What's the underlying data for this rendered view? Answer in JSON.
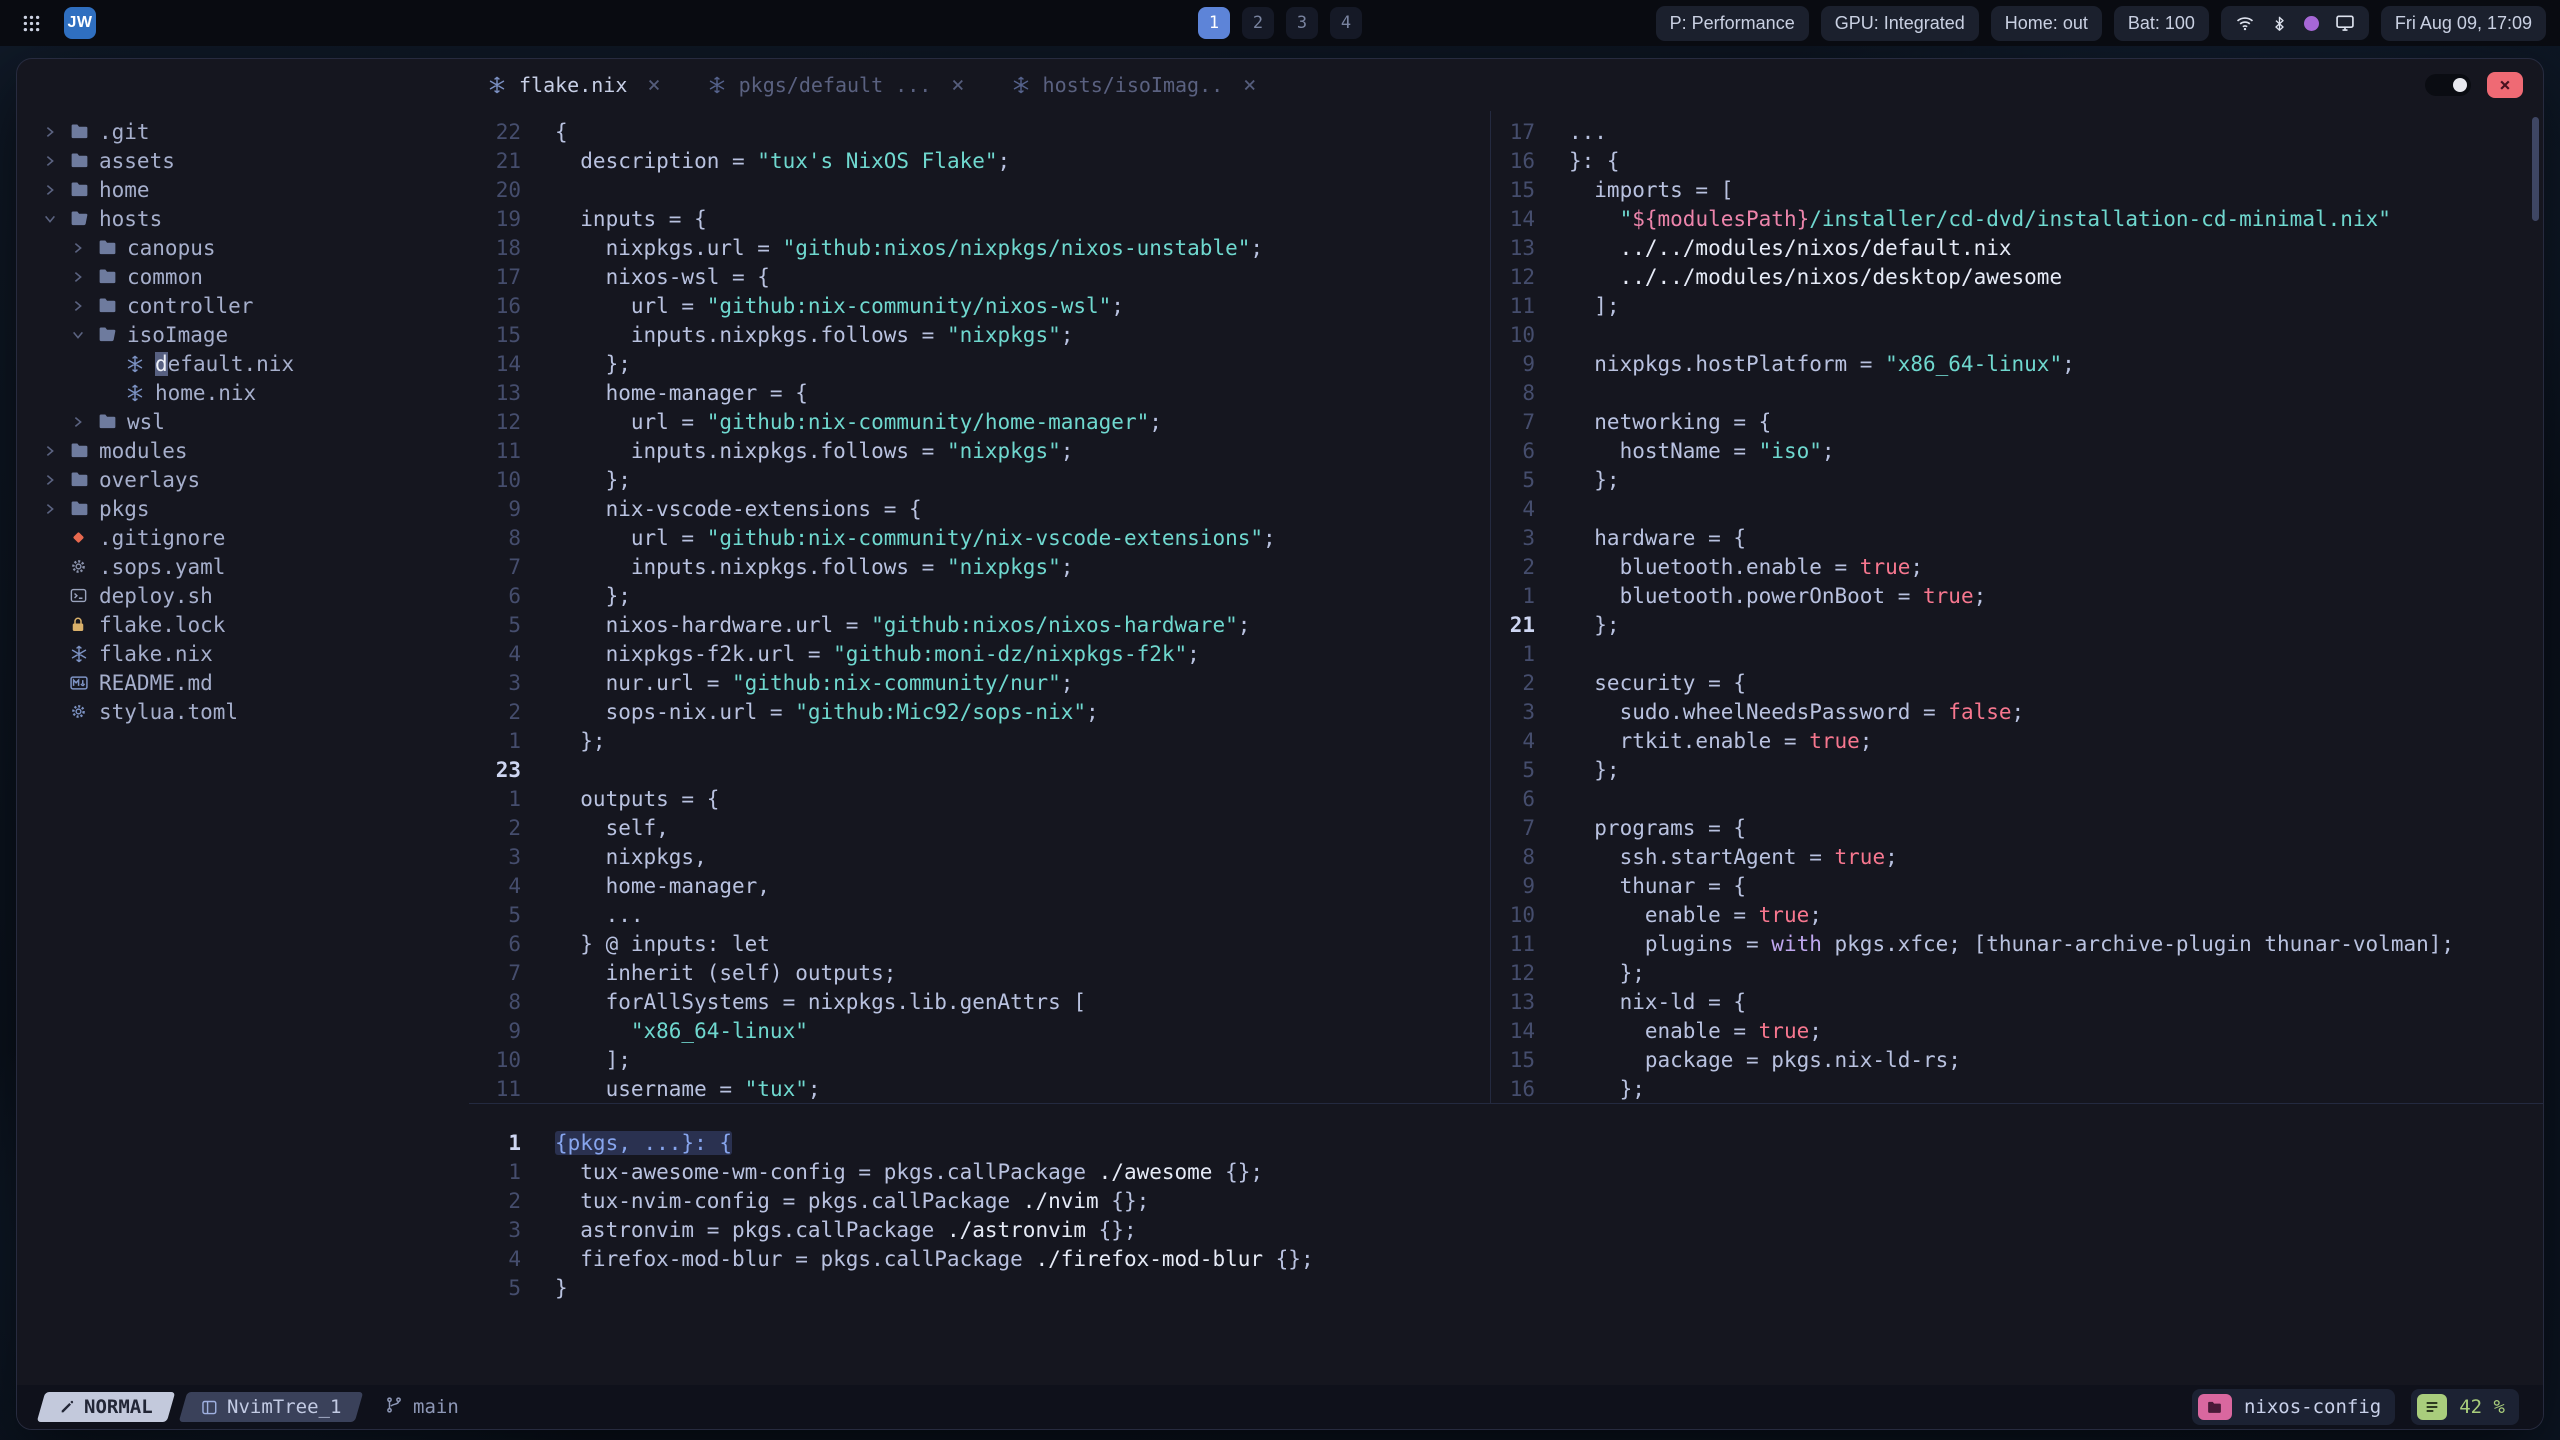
{
  "topbar": {
    "apps_icon": "apps-grid",
    "logo_badge": "JW",
    "workspaces": [
      {
        "label": "1",
        "active": true
      },
      {
        "label": "2",
        "active": false
      },
      {
        "label": "3",
        "active": false
      },
      {
        "label": "4",
        "active": false
      }
    ],
    "status_items": [
      "P: Performance",
      "GPU: Integrated",
      "Home: out",
      "Bat: 100"
    ],
    "tray_icons": [
      "wifi",
      "bluetooth",
      "color-dot",
      "display"
    ],
    "clock": "Fri Aug 09, 17:09"
  },
  "window_controls": {
    "close_glyph": "×"
  },
  "tabline": {
    "close_glyph": "×",
    "tabs": [
      {
        "icon": "nix",
        "label": "flake.nix",
        "active": true
      },
      {
        "icon": "nix",
        "label": "pkgs/default ...",
        "active": false
      },
      {
        "icon": "nix",
        "label": "hosts/isoImag..",
        "active": false
      }
    ]
  },
  "tree": {
    "items": [
      {
        "label": ".git",
        "icon": "folder",
        "arrow": "closed",
        "depth": 0
      },
      {
        "label": "assets",
        "icon": "folder",
        "arrow": "closed",
        "depth": 0
      },
      {
        "label": "home",
        "icon": "folder",
        "arrow": "closed",
        "depth": 0
      },
      {
        "label": "hosts",
        "icon": "folder-open",
        "arrow": "open",
        "depth": 0
      },
      {
        "label": "canopus",
        "icon": "folder",
        "arrow": "closed",
        "depth": 1
      },
      {
        "label": "common",
        "icon": "folder",
        "arrow": "closed",
        "depth": 1
      },
      {
        "label": "controller",
        "icon": "folder",
        "arrow": "closed",
        "depth": 1
      },
      {
        "label": "isoImage",
        "icon": "folder-open",
        "arrow": "open",
        "depth": 1
      },
      {
        "label": "default.nix",
        "icon": "nix",
        "depth": 2,
        "cursor": true
      },
      {
        "label": "home.nix",
        "icon": "nix",
        "depth": 2
      },
      {
        "label": "wsl",
        "icon": "folder",
        "arrow": "closed",
        "depth": 1
      },
      {
        "label": "modules",
        "icon": "folder",
        "arrow": "closed",
        "depth": 0
      },
      {
        "label": "overlays",
        "icon": "folder",
        "arrow": "closed",
        "depth": 0
      },
      {
        "label": "pkgs",
        "icon": "folder",
        "arrow": "closed",
        "depth": 0
      },
      {
        "label": ".gitignore",
        "icon": "git",
        "depth": 0
      },
      {
        "label": ".sops.yaml",
        "icon": "gear-gray",
        "depth": 0
      },
      {
        "label": "deploy.sh",
        "icon": "terminal",
        "depth": 0
      },
      {
        "label": "flake.lock",
        "icon": "lock",
        "depth": 0
      },
      {
        "label": "flake.nix",
        "icon": "nix",
        "depth": 0
      },
      {
        "label": "README.md",
        "icon": "markdown",
        "depth": 0
      },
      {
        "label": "stylua.toml",
        "icon": "gear-blue",
        "depth": 0
      }
    ]
  },
  "editors": {
    "left": [
      {
        "n": "22",
        "s": [
          [
            "t",
            "{"
          ]
        ]
      },
      {
        "n": "21",
        "s": [
          [
            "t",
            "  description = "
          ],
          [
            "s",
            "\"tux's NixOS Flake\""
          ],
          [
            "t",
            ";"
          ]
        ]
      },
      {
        "n": "20",
        "s": []
      },
      {
        "n": "19",
        "s": [
          [
            "t",
            "  inputs = {"
          ]
        ]
      },
      {
        "n": "18",
        "s": [
          [
            "t",
            "    nixpkgs.url = "
          ],
          [
            "s",
            "\"github:nixos/nixpkgs/nixos-unstable\""
          ],
          [
            "t",
            ";"
          ]
        ]
      },
      {
        "n": "17",
        "s": [
          [
            "t",
            "    nixos-wsl = {"
          ]
        ]
      },
      {
        "n": "16",
        "s": [
          [
            "t",
            "      url = "
          ],
          [
            "s",
            "\"github:nix-community/nixos-wsl\""
          ],
          [
            "t",
            ";"
          ]
        ]
      },
      {
        "n": "15",
        "s": [
          [
            "t",
            "      inputs.nixpkgs.follows = "
          ],
          [
            "s",
            "\"nixpkgs\""
          ],
          [
            "t",
            ";"
          ]
        ]
      },
      {
        "n": "14",
        "s": [
          [
            "t",
            "    };"
          ]
        ]
      },
      {
        "n": "13",
        "s": [
          [
            "t",
            "    home-manager = {"
          ]
        ]
      },
      {
        "n": "12",
        "s": [
          [
            "t",
            "      url = "
          ],
          [
            "s",
            "\"github:nix-community/home-manager\""
          ],
          [
            "t",
            ";"
          ]
        ]
      },
      {
        "n": "11",
        "s": [
          [
            "t",
            "      inputs.nixpkgs.follows = "
          ],
          [
            "s",
            "\"nixpkgs\""
          ],
          [
            "t",
            ";"
          ]
        ]
      },
      {
        "n": "10",
        "s": [
          [
            "t",
            "    };"
          ]
        ]
      },
      {
        "n": "9",
        "s": [
          [
            "t",
            "    nix-vscode-extensions = {"
          ]
        ]
      },
      {
        "n": "8",
        "s": [
          [
            "t",
            "      url = "
          ],
          [
            "s",
            "\"github:nix-community/nix-vscode-extensions\""
          ],
          [
            "t",
            ";"
          ]
        ]
      },
      {
        "n": "7",
        "s": [
          [
            "t",
            "      inputs.nixpkgs.follows = "
          ],
          [
            "s",
            "\"nixpkgs\""
          ],
          [
            "t",
            ";"
          ]
        ]
      },
      {
        "n": "6",
        "s": [
          [
            "t",
            "    };"
          ]
        ]
      },
      {
        "n": "5",
        "s": [
          [
            "t",
            "    nixos-hardware.url = "
          ],
          [
            "s",
            "\"github:nixos/nixos-hardware\""
          ],
          [
            "t",
            ";"
          ]
        ]
      },
      {
        "n": "4",
        "s": [
          [
            "t",
            "    nixpkgs-f2k.url = "
          ],
          [
            "s",
            "\"github:moni-dz/nixpkgs-f2k\""
          ],
          [
            "t",
            ";"
          ]
        ]
      },
      {
        "n": "3",
        "s": [
          [
            "t",
            "    nur.url = "
          ],
          [
            "s",
            "\"github:nix-community/nur\""
          ],
          [
            "t",
            ";"
          ]
        ]
      },
      {
        "n": "2",
        "s": [
          [
            "t",
            "    sops-nix.url = "
          ],
          [
            "s",
            "\"github:Mic92/sops-nix\""
          ],
          [
            "t",
            ";"
          ]
        ]
      },
      {
        "n": "1",
        "s": [
          [
            "t",
            "  };"
          ]
        ]
      },
      {
        "n": "23",
        "cur": true,
        "s": []
      },
      {
        "n": "1",
        "s": [
          [
            "t",
            "  outputs = {"
          ]
        ]
      },
      {
        "n": "2",
        "s": [
          [
            "t",
            "    self,"
          ]
        ]
      },
      {
        "n": "3",
        "s": [
          [
            "t",
            "    nixpkgs,"
          ]
        ]
      },
      {
        "n": "4",
        "s": [
          [
            "t",
            "    home-manager,"
          ]
        ]
      },
      {
        "n": "5",
        "s": [
          [
            "t",
            "    ..."
          ]
        ]
      },
      {
        "n": "6",
        "s": [
          [
            "t",
            "  } @ inputs: let"
          ]
        ]
      },
      {
        "n": "7",
        "s": [
          [
            "t",
            "    inherit (self) outputs;"
          ]
        ]
      },
      {
        "n": "8",
        "s": [
          [
            "t",
            "    forAllSystems = nixpkgs.lib.genAttrs ["
          ]
        ]
      },
      {
        "n": "9",
        "s": [
          [
            "t",
            "      "
          ],
          [
            "s",
            "\"x86_64-linux\""
          ]
        ]
      },
      {
        "n": "10",
        "s": [
          [
            "t",
            "    ];"
          ]
        ]
      },
      {
        "n": "11",
        "s": [
          [
            "t",
            "    username = "
          ],
          [
            "s",
            "\"tux\""
          ],
          [
            "t",
            ";"
          ]
        ]
      }
    ],
    "right": [
      {
        "n": "17",
        "s": [
          [
            "t",
            "..."
          ]
        ]
      },
      {
        "n": "16",
        "s": [
          [
            "t",
            "}: {"
          ]
        ]
      },
      {
        "n": "15",
        "s": [
          [
            "t",
            "  imports = ["
          ]
        ]
      },
      {
        "n": "14",
        "s": [
          [
            "t",
            "    "
          ],
          [
            "s",
            "\""
          ],
          [
            "i",
            "${modulesPath}"
          ],
          [
            "s",
            "/installer/cd-dvd/installation-cd-minimal.nix\""
          ]
        ]
      },
      {
        "n": "13",
        "s": [
          [
            "t",
            "    "
          ],
          [
            "p",
            "../../modules/nixos/default.nix"
          ]
        ]
      },
      {
        "n": "12",
        "s": [
          [
            "t",
            "    "
          ],
          [
            "p",
            "../../modules/nixos/desktop/awesome"
          ]
        ]
      },
      {
        "n": "11",
        "s": [
          [
            "t",
            "  ];"
          ]
        ]
      },
      {
        "n": "10",
        "s": []
      },
      {
        "n": "9",
        "s": [
          [
            "t",
            "  nixpkgs.hostPlatform = "
          ],
          [
            "s",
            "\"x86_64-linux\""
          ],
          [
            "t",
            ";"
          ]
        ]
      },
      {
        "n": "8",
        "s": []
      },
      {
        "n": "7",
        "s": [
          [
            "t",
            "  networking = {"
          ]
        ]
      },
      {
        "n": "6",
        "s": [
          [
            "t",
            "    hostName = "
          ],
          [
            "s",
            "\"iso\""
          ],
          [
            "t",
            ";"
          ]
        ]
      },
      {
        "n": "5",
        "s": [
          [
            "t",
            "  };"
          ]
        ]
      },
      {
        "n": "4",
        "s": []
      },
      {
        "n": "3",
        "s": [
          [
            "t",
            "  hardware = {"
          ]
        ]
      },
      {
        "n": "2",
        "s": [
          [
            "t",
            "    bluetooth.enable = "
          ],
          [
            "b",
            "true"
          ],
          [
            "t",
            ";"
          ]
        ]
      },
      {
        "n": "1",
        "s": [
          [
            "t",
            "    bluetooth.powerOnBoot = "
          ],
          [
            "b",
            "true"
          ],
          [
            "t",
            ";"
          ]
        ]
      },
      {
        "n": "21",
        "cur": true,
        "s": [
          [
            "t",
            "  };"
          ]
        ]
      },
      {
        "n": "1",
        "s": []
      },
      {
        "n": "2",
        "s": [
          [
            "t",
            "  security = {"
          ]
        ]
      },
      {
        "n": "3",
        "s": [
          [
            "t",
            "    sudo.wheelNeedsPassword = "
          ],
          [
            "b",
            "false"
          ],
          [
            "t",
            ";"
          ]
        ]
      },
      {
        "n": "4",
        "s": [
          [
            "t",
            "    rtkit.enable = "
          ],
          [
            "b",
            "true"
          ],
          [
            "t",
            ";"
          ]
        ]
      },
      {
        "n": "5",
        "s": [
          [
            "t",
            "  };"
          ]
        ]
      },
      {
        "n": "6",
        "s": []
      },
      {
        "n": "7",
        "s": [
          [
            "t",
            "  programs = {"
          ]
        ]
      },
      {
        "n": "8",
        "s": [
          [
            "t",
            "    ssh.startAgent = "
          ],
          [
            "b",
            "true"
          ],
          [
            "t",
            ";"
          ]
        ]
      },
      {
        "n": "9",
        "s": [
          [
            "t",
            "    thunar = {"
          ]
        ]
      },
      {
        "n": "10",
        "s": [
          [
            "t",
            "      enable = "
          ],
          [
            "b",
            "true"
          ],
          [
            "t",
            ";"
          ]
        ]
      },
      {
        "n": "11",
        "s": [
          [
            "t",
            "      plugins = "
          ],
          [
            "k",
            "with"
          ],
          [
            "t",
            " pkgs.xfce; [thunar-archive-plugin thunar-volman];"
          ]
        ]
      },
      {
        "n": "12",
        "s": [
          [
            "t",
            "    };"
          ]
        ]
      },
      {
        "n": "13",
        "s": [
          [
            "t",
            "    nix-ld = {"
          ]
        ]
      },
      {
        "n": "14",
        "s": [
          [
            "t",
            "      enable = "
          ],
          [
            "b",
            "true"
          ],
          [
            "t",
            ";"
          ]
        ]
      },
      {
        "n": "15",
        "s": [
          [
            "t",
            "      package = pkgs.nix-ld-rs;"
          ]
        ]
      },
      {
        "n": "16",
        "s": [
          [
            "t",
            "    };"
          ]
        ]
      }
    ],
    "bottom": [
      {
        "n": "1",
        "cur": true,
        "s": [
          [
            "hl",
            "{pkgs, ...}: {"
          ]
        ]
      },
      {
        "n": "1",
        "s": [
          [
            "t",
            "  tux-awesome-wm-config = pkgs.callPackage "
          ],
          [
            "p",
            "./awesome"
          ],
          [
            "t",
            " {};"
          ]
        ]
      },
      {
        "n": "2",
        "s": [
          [
            "t",
            "  tux-nvim-config = pkgs.callPackage "
          ],
          [
            "p",
            "./nvim"
          ],
          [
            "t",
            " {};"
          ]
        ]
      },
      {
        "n": "3",
        "s": [
          [
            "t",
            "  astronvim = pkgs.callPackage "
          ],
          [
            "p",
            "./astronvim"
          ],
          [
            "t",
            " {};"
          ]
        ]
      },
      {
        "n": "4",
        "s": [
          [
            "t",
            "  firefox-mod-blur = pkgs.callPackage "
          ],
          [
            "p",
            "./firefox-mod-blur"
          ],
          [
            "t",
            " {};"
          ]
        ]
      },
      {
        "n": "5",
        "s": [
          [
            "t",
            "}"
          ]
        ]
      }
    ]
  },
  "statusline": {
    "mode": "NORMAL",
    "buffer": "NvimTree_1",
    "branch": "main",
    "project": "nixos-config",
    "progress": "42 %"
  },
  "colors": {
    "accent_blue": "#5d84d8",
    "string_teal": "#6fd8cf",
    "boolean_pink": "#f7778f",
    "close_red": "#ef6a74",
    "project_pink": "#d9679f",
    "progress_green": "#a9cd7c"
  }
}
